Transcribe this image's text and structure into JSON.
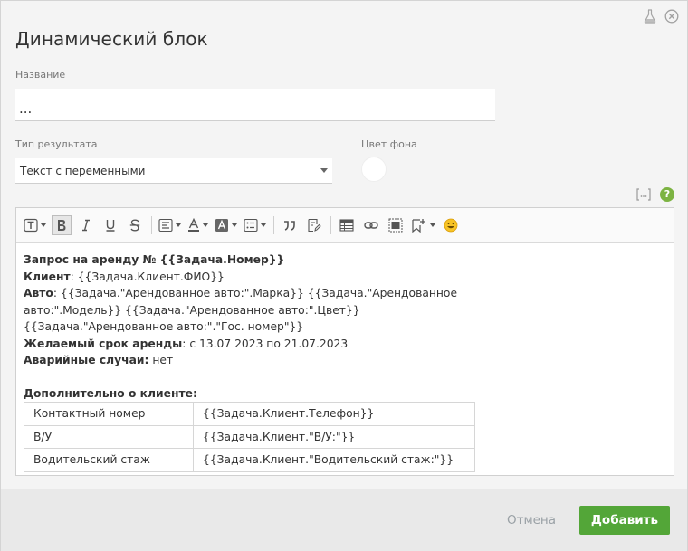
{
  "dialog": {
    "title": "Динамический блок",
    "top_icons": [
      "flask-icon",
      "close-icon"
    ]
  },
  "name_field": {
    "label": "Название",
    "value": "..."
  },
  "result_type": {
    "label": "Тип результата",
    "selected": "Текст с переменными"
  },
  "bg_color": {
    "label": "Цвет фона",
    "value": "#ffffff"
  },
  "toolbar": {
    "text_style_glyph": "T",
    "bold_glyph": "B",
    "italic_glyph": "I",
    "underline_glyph": "U",
    "strike_glyph": "S",
    "font_color_glyph": "A",
    "bg_color_glyph": "A",
    "quote_glyph": "”"
  },
  "content": {
    "line1_bold": "Запрос на аренду № {{Задача.Номер}}",
    "line2_bold": "Клиент",
    "line2_rest": ": {{Задача.Клиент.ФИО}}",
    "line3_bold": "Авто",
    "line3_rest": ": {{Задача.\"Арендованное авто:\".Марка}} {{Задача.\"Арендованное",
    "line4": "авто:\".Модель}} {{Задача.\"Арендованное авто:\".Цвет}}",
    "line5": "{{Задача.\"Арендованное авто:\".\"Гос. номер\"}}",
    "line6_bold": "Желаемый срок аренды",
    "line6_rest": ": с 13.07 2023 по 21.07.2023",
    "line7_bold": "Аварийные случаи:",
    "line7_rest": " нет",
    "section_bold": "Дополнительно о клиенте:",
    "table": [
      {
        "label": "Контактный номер",
        "value": "{{Задача.Клиент.Телефон}}"
      },
      {
        "label": "В/У",
        "value": "{{Задача.Клиент.\"В/У:\"}}"
      },
      {
        "label": "Водительский стаж",
        "value": "{{Задача.Клиент.\"Водительский стаж:\"}}"
      }
    ]
  },
  "footer": {
    "cancel_label": "Отмена",
    "add_label": "Добавить"
  },
  "colors": {
    "accent": "#53a638",
    "help": "#7cb342"
  }
}
